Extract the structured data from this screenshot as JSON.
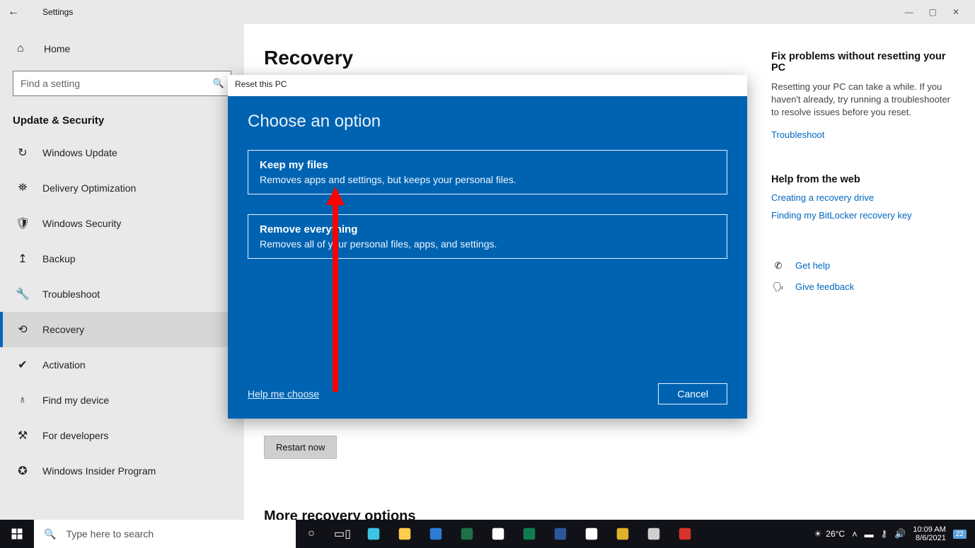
{
  "window": {
    "caption": "Settings"
  },
  "sidebar": {
    "home": "Home",
    "search_placeholder": "Find a setting",
    "section_label": "Update & Security",
    "items": [
      {
        "label": "Windows Update",
        "glyph": "↻"
      },
      {
        "label": "Delivery Optimization",
        "glyph": "⛯"
      },
      {
        "label": "Windows Security",
        "glyph": "🛡"
      },
      {
        "label": "Backup",
        "glyph": "↥"
      },
      {
        "label": "Troubleshoot",
        "glyph": "🔧"
      },
      {
        "label": "Recovery",
        "glyph": "⟲"
      },
      {
        "label": "Activation",
        "glyph": "✔"
      },
      {
        "label": "Find my device",
        "glyph": "♁"
      },
      {
        "label": "For developers",
        "glyph": "⚒"
      },
      {
        "label": "Windows Insider Program",
        "glyph": "✪"
      }
    ],
    "selected_index": 5
  },
  "main": {
    "page_title": "Recovery",
    "restart_now": "Restart now",
    "more_title": "More recovery options"
  },
  "right": {
    "fix_heading": "Fix problems without resetting your PC",
    "fix_body": "Resetting your PC can take a while. If you haven't already, try running a troubleshooter to resolve issues before you reset.",
    "troubleshoot_link": "Troubleshoot",
    "web_heading": "Help from the web",
    "web_links": [
      "Creating a recovery drive",
      "Finding my BitLocker recovery key"
    ],
    "get_help": "Get help",
    "give_feedback": "Give feedback"
  },
  "modal": {
    "title_bar": "Reset this PC",
    "heading": "Choose an option",
    "options": [
      {
        "title": "Keep my files",
        "desc": "Removes apps and settings, but keeps your personal files."
      },
      {
        "title": "Remove everything",
        "desc": "Removes all of your personal files, apps, and settings."
      }
    ],
    "help_me": "Help me choose",
    "cancel": "Cancel"
  },
  "taskbar": {
    "search_placeholder": "Type here to search",
    "weather_temp": "26°C",
    "time": "10:09 AM",
    "date": "8/6/2021",
    "notif_count": "22",
    "pinned": [
      {
        "name": "cortana",
        "color": "#ffffff",
        "glyph": "○"
      },
      {
        "name": "task-view",
        "color": "#ffffff",
        "glyph": "▭▯"
      },
      {
        "name": "edge",
        "color": "#3cc4e6"
      },
      {
        "name": "file-explorer",
        "color": "#ffcc4d"
      },
      {
        "name": "mail",
        "color": "#2b7cd3"
      },
      {
        "name": "excel",
        "color": "#1e7145"
      },
      {
        "name": "store",
        "color": "#ffffff"
      },
      {
        "name": "project",
        "color": "#0f7c4f"
      },
      {
        "name": "word",
        "color": "#2b579a"
      },
      {
        "name": "chrome",
        "color": "#ffffff"
      },
      {
        "name": "folder2",
        "color": "#e1b12c"
      },
      {
        "name": "settings",
        "color": "#cfcfcf"
      },
      {
        "name": "acrobat",
        "color": "#d8332a"
      }
    ]
  }
}
